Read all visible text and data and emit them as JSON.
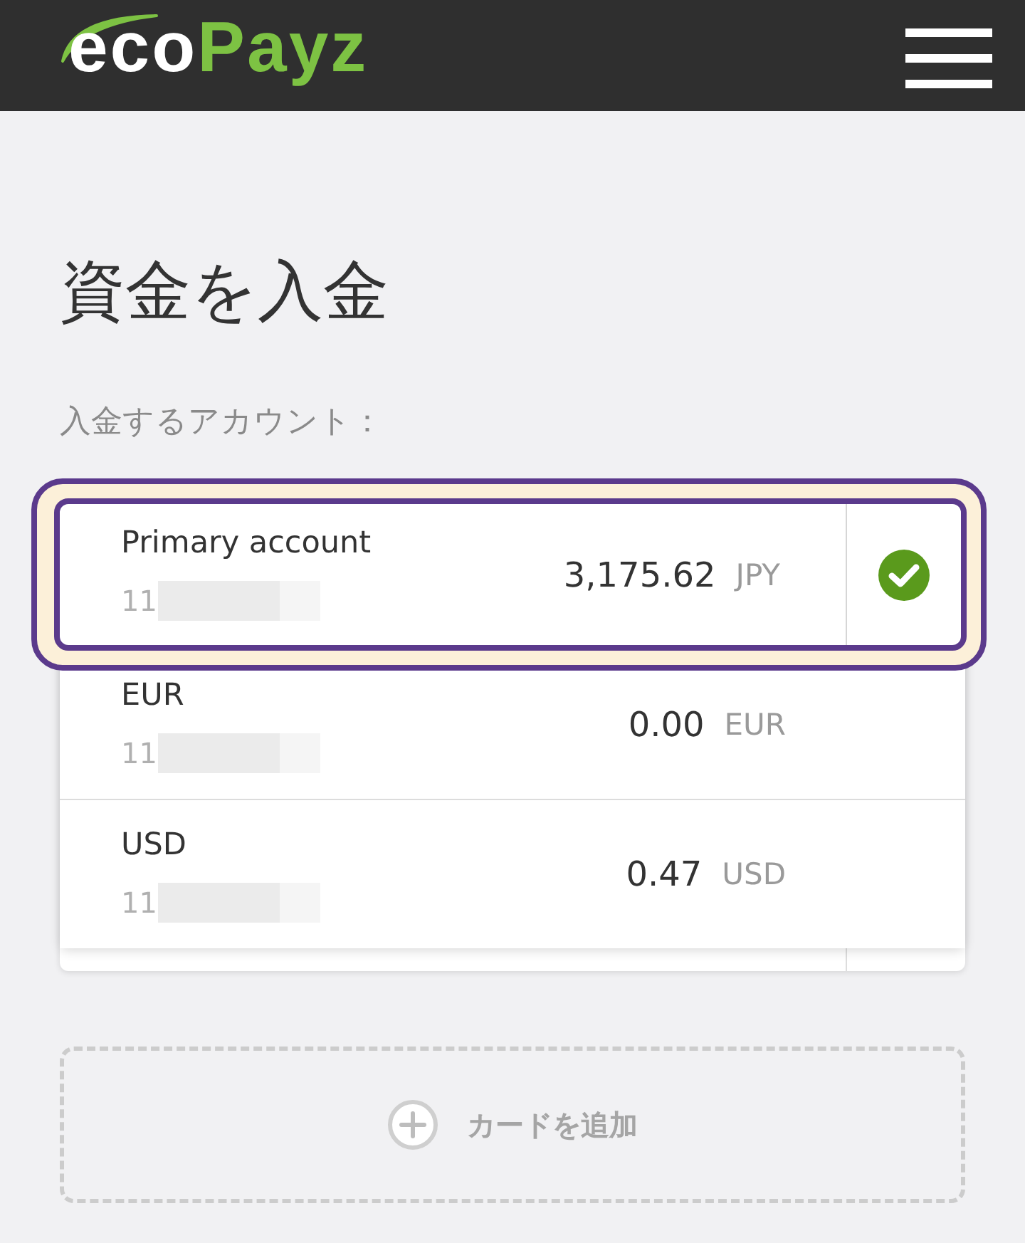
{
  "header": {
    "logo": [
      "eco",
      "Payz"
    ]
  },
  "page_title": "資金を入金",
  "account_label": "入金するアカウント：",
  "accounts": [
    {
      "name": "Primary account",
      "number": "11",
      "balance": "3,175.62",
      "currency": "JPY",
      "selected": true
    },
    {
      "name": "EUR",
      "number": "11",
      "balance": "0.00",
      "currency": "EUR",
      "selected": false
    },
    {
      "name": "USD",
      "number": "11",
      "balance": "0.47",
      "currency": "USD",
      "selected": false
    }
  ],
  "add_card": {
    "label": "カードを追加"
  }
}
